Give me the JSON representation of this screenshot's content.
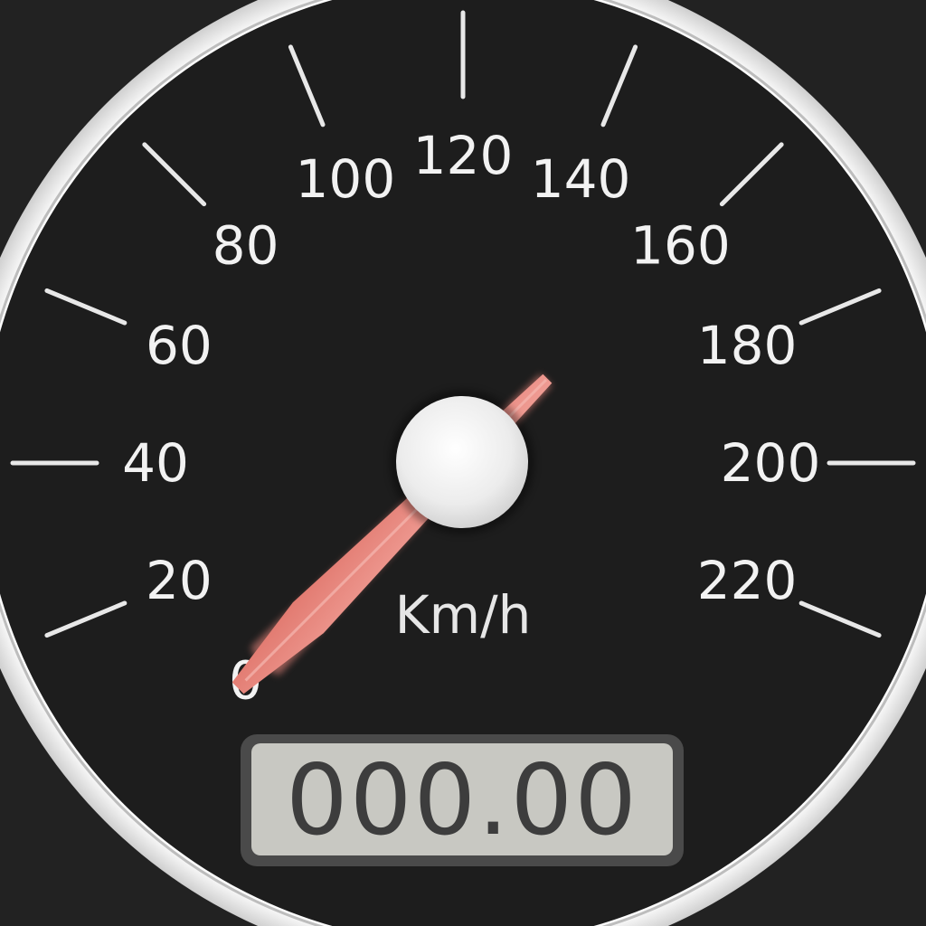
{
  "speedometer": {
    "unit": "Km/h",
    "odometer": "000.00",
    "current_speed": 0,
    "scale_min": 0,
    "scale_max": 240,
    "tick_labels": [
      "0",
      "20",
      "40",
      "60",
      "80",
      "100",
      "120",
      "140",
      "160",
      "180",
      "200",
      "220"
    ]
  },
  "colors": {
    "background": "#222222",
    "dial_face": "#1d1d1d",
    "bezel": "#f4f4f4",
    "tick_label": "#f2f2f2",
    "needle": "#e8857c",
    "hub": "#f0f0f0",
    "odometer_bg": "#c8c8c2",
    "odometer_text": "#3d3d3d"
  }
}
